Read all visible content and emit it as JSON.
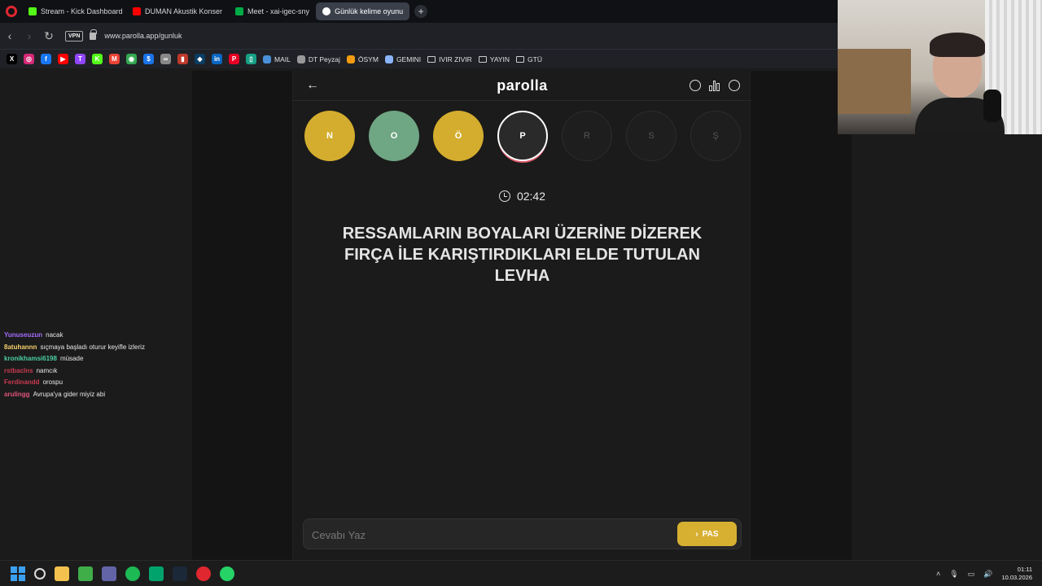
{
  "browser": {
    "tabs": [
      {
        "label": "Stream - Kick Dashboard",
        "color": "#53fc18",
        "active": false
      },
      {
        "label": "DUMAN Akustik Konser",
        "color": "#ff0000",
        "active": false
      },
      {
        "label": "Meet - xai-igec-sny",
        "color": "#00ac47",
        "active": false
      },
      {
        "label": "Günlük kelime oyunu",
        "color": "#ffffff",
        "active": true
      }
    ],
    "new_tab": "+",
    "vpn": "VPN",
    "url": "www.parolla.app/gunluk",
    "bookmark_icons": [
      {
        "name": "x-icon",
        "glyph": "X",
        "color": "#000000"
      },
      {
        "name": "instagram-icon",
        "glyph": "◎",
        "color": "#d62976"
      },
      {
        "name": "facebook-icon",
        "glyph": "f",
        "color": "#1877f2"
      },
      {
        "name": "youtube-icon",
        "glyph": "▶",
        "color": "#ff0000"
      },
      {
        "name": "twitch-icon",
        "glyph": "T",
        "color": "#9146ff"
      },
      {
        "name": "kick-icon",
        "glyph": "K",
        "color": "#53fc18"
      },
      {
        "name": "gmail-icon",
        "glyph": "M",
        "color": "#ea4335"
      },
      {
        "name": "maps-icon",
        "glyph": "◉",
        "color": "#34a853"
      },
      {
        "name": "dollar-icon",
        "glyph": "$",
        "color": "#1a73e8"
      },
      {
        "name": "glasses-icon",
        "glyph": "∞",
        "color": "#888888"
      },
      {
        "name": "bank-icon",
        "glyph": "▮",
        "color": "#c0392b"
      },
      {
        "name": "blue-icon",
        "glyph": "◆",
        "color": "#0a3d62"
      },
      {
        "name": "linkedin-icon",
        "glyph": "in",
        "color": "#0a66c2"
      },
      {
        "name": "pinterest-icon",
        "glyph": "P",
        "color": "#e60023"
      },
      {
        "name": "phone-icon",
        "glyph": "▯",
        "color": "#16a085"
      }
    ],
    "bookmarks": [
      {
        "label": "MAIL",
        "icon": "mail-icon",
        "color": "#4a90d9"
      },
      {
        "label": "DT Peyzaj",
        "icon": "doc-icon",
        "color": "#999999"
      },
      {
        "label": "ÖSYM",
        "icon": "osym-icon",
        "color": "#f39c12"
      },
      {
        "label": "GEMINI",
        "icon": "gemini-icon",
        "color": "#8ab4f8"
      },
      {
        "label": "IVIR ZIVIR",
        "icon": "folder-icon",
        "color": "#cccccc"
      },
      {
        "label": "YAYIN",
        "icon": "folder-icon",
        "color": "#cccccc"
      },
      {
        "label": "GTÜ",
        "icon": "folder-icon",
        "color": "#cccccc"
      }
    ]
  },
  "chat": [
    {
      "user": "Yunuseuzun",
      "color": "#a66cff",
      "message": "nacak"
    },
    {
      "user": "8atuhannn",
      "color": "#f5d06b",
      "message": "sıçmaya başladı oturur keyifle izleriz"
    },
    {
      "user": "kronikhamsi6198",
      "color": "#4cd0a0",
      "message": "müsade"
    },
    {
      "user": "rstbaclns",
      "color": "#c93b50",
      "message": "namcık"
    },
    {
      "user": "Ferdinandd",
      "color": "#c93b50",
      "message": "orospu"
    },
    {
      "user": "arulingg",
      "color": "#e0557a",
      "message": "Avrupa'ya gider miyiz abi"
    }
  ],
  "game": {
    "back": "←",
    "logo": "parolla",
    "letters": [
      {
        "char": "N",
        "state": "wrong"
      },
      {
        "char": "O",
        "state": "right"
      },
      {
        "char": "Ö",
        "state": "wrong"
      },
      {
        "char": "P",
        "state": "current"
      },
      {
        "char": "R",
        "state": "pending"
      },
      {
        "char": "S",
        "state": "pending"
      },
      {
        "char": "Ş",
        "state": "pending"
      }
    ],
    "timer": "02:42",
    "question": "RESSAMLARIN BOYALARI ÜZERİNE DİZEREK FIRÇA İLE KARIŞTIRDIKLARI ELDE TUTULAN LEVHA",
    "answer_placeholder": "Cevabı Yaz",
    "pas_label": "PAS",
    "colors": {
      "wrong": "#d4ad2e",
      "right": "#6fa683",
      "accent": "#d7b032"
    }
  },
  "taskbar": {
    "apps": [
      {
        "name": "search-icon",
        "color": "#2b2b2b"
      },
      {
        "name": "file-explorer-icon",
        "color": "#f2c14e"
      },
      {
        "name": "xbox-icon",
        "color": "#3fae49"
      },
      {
        "name": "teams-icon",
        "color": "#6264a7"
      },
      {
        "name": "spotify-icon",
        "color": "#1db954"
      },
      {
        "name": "app-green-icon",
        "color": "#00a36c"
      },
      {
        "name": "steam-icon",
        "color": "#1b2838"
      },
      {
        "name": "opera-icon",
        "color": "#e0262e"
      },
      {
        "name": "whatsapp-icon",
        "color": "#25d366"
      }
    ],
    "time": "01:11",
    "date": "10.03.2026"
  }
}
